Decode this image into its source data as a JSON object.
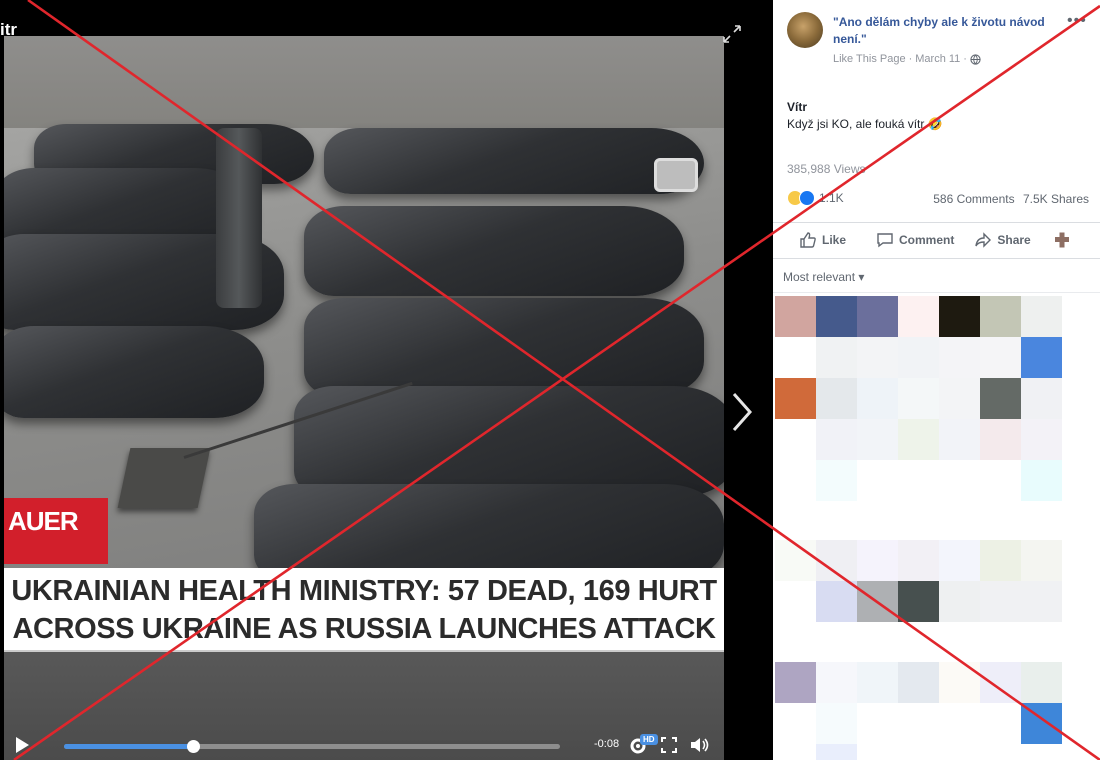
{
  "video": {
    "title": "itr",
    "badge_text": "AUER",
    "caption_line1": "UKRAINIAN HEALTH MINISTRY: 57 DEAD, 169 HURT",
    "caption_line2": "ACROSS UKRAINE AS RUSSIA LAUNCHES ATTACK",
    "time_remaining": "-0:08",
    "hd_label": "HD",
    "progress": 0.26,
    "accent_color": "#4a90e2"
  },
  "post": {
    "page_name": "\"Ano dělám chyby ale k životu návod není.\"",
    "like_page": "Like This Page",
    "date": "March 11",
    "author": "Vítr",
    "text": "Když jsi KO, ale fouká vítr 🤣",
    "views": "385,988 Views",
    "reaction_count": "1.1K",
    "comments": "586 Comments",
    "shares": "7.5K Shares",
    "link_color": "#365899"
  },
  "actions": {
    "like": "Like",
    "comment": "Comment",
    "share": "Share"
  },
  "comments": {
    "sort_label": "Most relevant ▾"
  },
  "overlay": {
    "x_color": "#e0262c"
  },
  "icons": [
    "fullscreen-icon",
    "chevron-right-icon",
    "play-icon",
    "gear-icon",
    "expand-icon",
    "volume-icon",
    "more-icon",
    "globe-icon",
    "like-icon",
    "comment-icon",
    "share-icon",
    "messenger-icon"
  ]
}
